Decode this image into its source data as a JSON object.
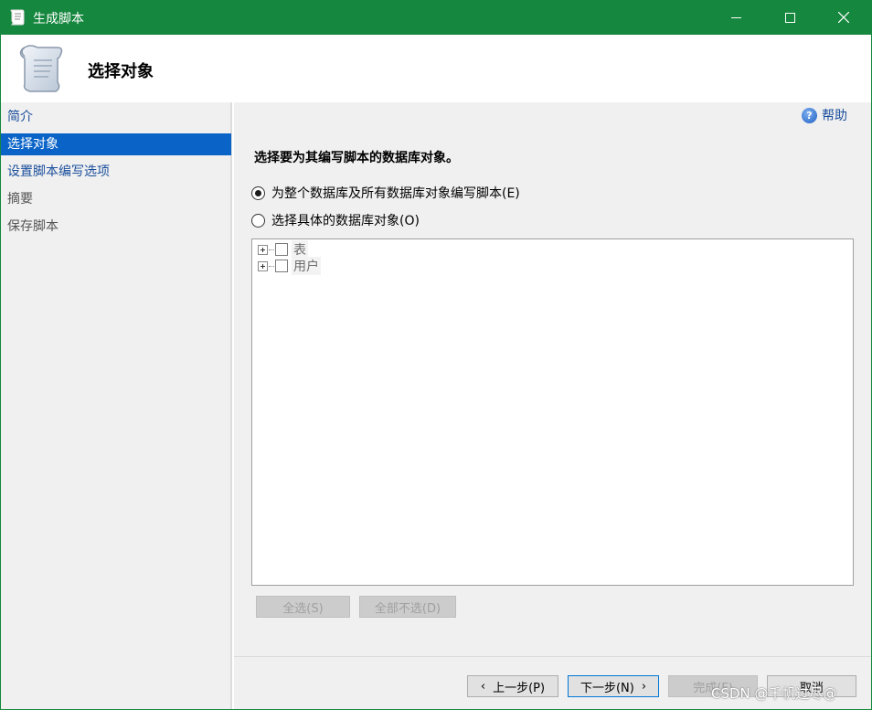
{
  "window": {
    "title": "生成脚本"
  },
  "header": {
    "title": "选择对象"
  },
  "sidebar": {
    "items": [
      {
        "label": "简介",
        "state": "link"
      },
      {
        "label": "选择对象",
        "state": "active"
      },
      {
        "label": "设置脚本编写选项",
        "state": "link"
      },
      {
        "label": "摘要",
        "state": "disabled"
      },
      {
        "label": "保存脚本",
        "state": "disabled"
      }
    ]
  },
  "main": {
    "help_label": "帮助",
    "instruction": "选择要为其编写脚本的数据库对象。",
    "options": [
      {
        "label": "为整个数据库及所有数据库对象编写脚本(E)",
        "checked": true
      },
      {
        "label": "选择具体的数据库对象(O)",
        "checked": false
      }
    ],
    "tree": [
      {
        "label": "表"
      },
      {
        "label": "用户"
      }
    ],
    "select_all": "全选(S)",
    "deselect_all": "全部不选(D)"
  },
  "footer": {
    "prev": "上一步(P)",
    "next": "下一步(N)",
    "finish": "完成(F)",
    "cancel": "取消"
  },
  "watermark": "CSDN @千帆过尽@",
  "colors": {
    "titlebar": "#15873e",
    "selection": "#0a64c8",
    "link": "#1a4e9c"
  }
}
